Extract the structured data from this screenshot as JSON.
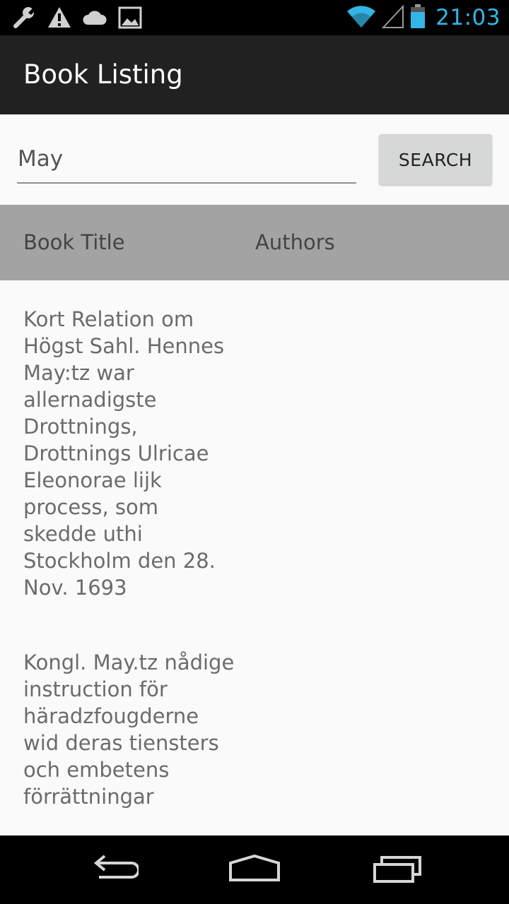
{
  "status_bar": {
    "time": "21:03",
    "icons": [
      "wrench-icon",
      "warning-icon",
      "cloud-icon",
      "image-icon",
      "wifi-icon",
      "signal-icon",
      "battery-icon"
    ],
    "clock_color": "#33b5e5"
  },
  "action_bar": {
    "title": "Book Listing"
  },
  "search": {
    "value": "May",
    "button_label": "SEARCH"
  },
  "table": {
    "headers": [
      "Book Title",
      "Authors"
    ],
    "rows": [
      {
        "title": "Kort Relation om Högst Sahl. Hennes May:tz war allernadigste Drottnings, Drottnings Ulricae Eleonorae lijk process, som skedde uthi Stockholm den 28. Nov. 1693",
        "authors": ""
      },
      {
        "title": "Kongl. May.tz nådige instruction för häradzfougderne wid deras tiensters och embetens förrättningar",
        "authors": ""
      }
    ]
  },
  "navigation": {
    "icons": [
      "back-icon",
      "home-icon",
      "recents-icon"
    ]
  },
  "colors": {
    "action_bar": "#212121",
    "header_row": "#a3a3a3",
    "button": "#d6d7d7",
    "background": "#fafafa"
  }
}
